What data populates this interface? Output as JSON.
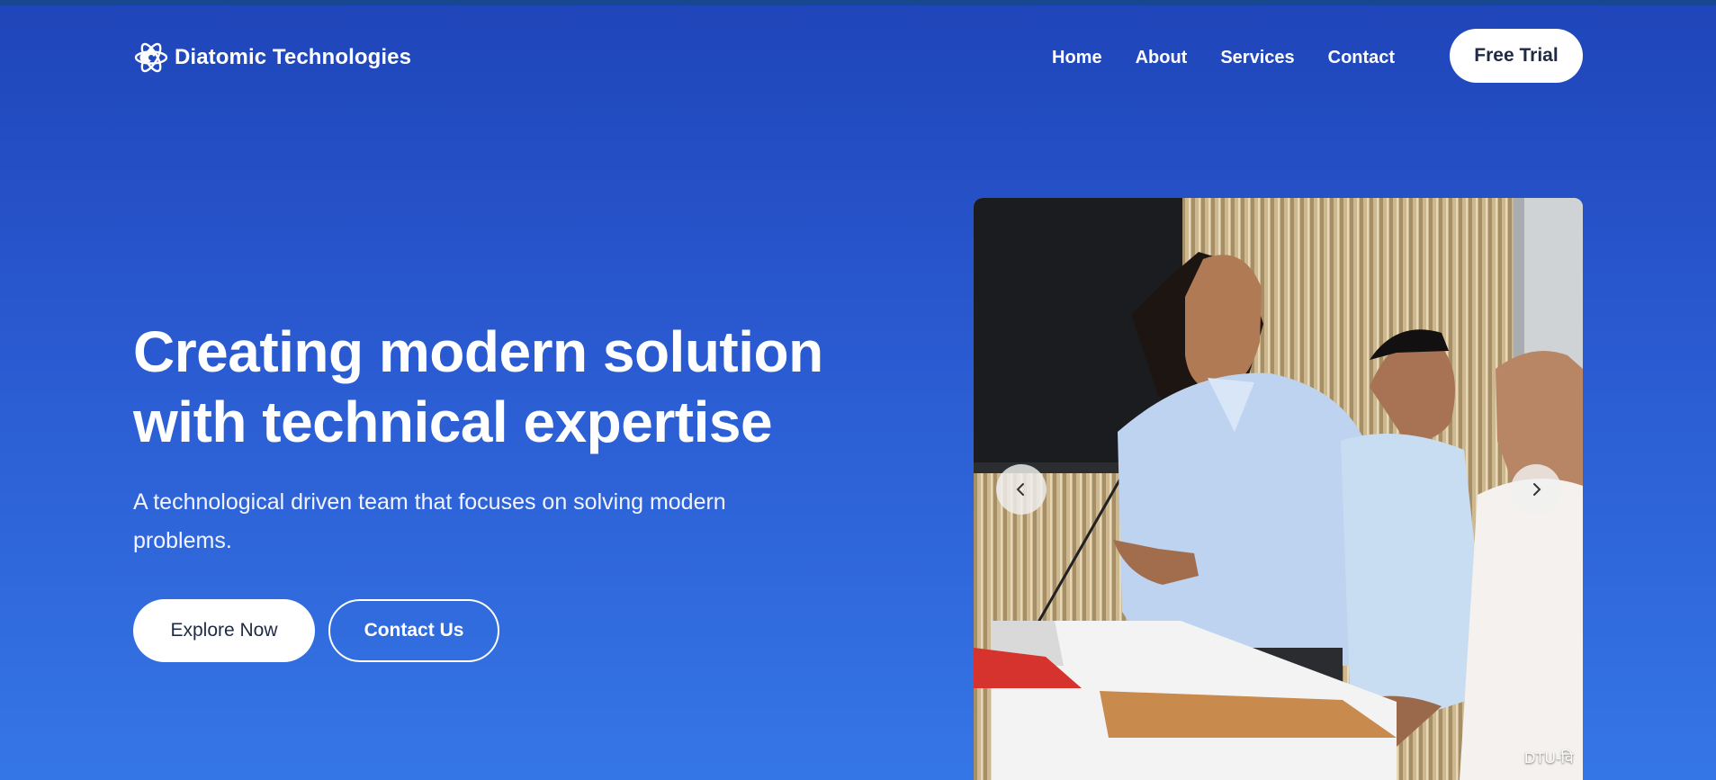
{
  "brand": {
    "name": "Diatomic Technologies",
    "icon": "atom-brain-icon"
  },
  "nav": {
    "links": [
      "Home",
      "About",
      "Services",
      "Contact"
    ],
    "cta": "Free Trial"
  },
  "hero": {
    "title_line1": "Creating modern solution",
    "title_line2": "with technical expertise",
    "subtitle": "A technological driven team that focuses on solving modern problems.",
    "primary_button": "Explore Now",
    "secondary_button": "Contact Us"
  },
  "carousel": {
    "caption": "DTU-वि",
    "prev_icon": "chevron-left-icon",
    "next_icon": "chevron-right-icon"
  },
  "colors": {
    "background_top": "#1f45b9",
    "background_bottom": "#3576e6",
    "button_text": "#1f2a44"
  }
}
